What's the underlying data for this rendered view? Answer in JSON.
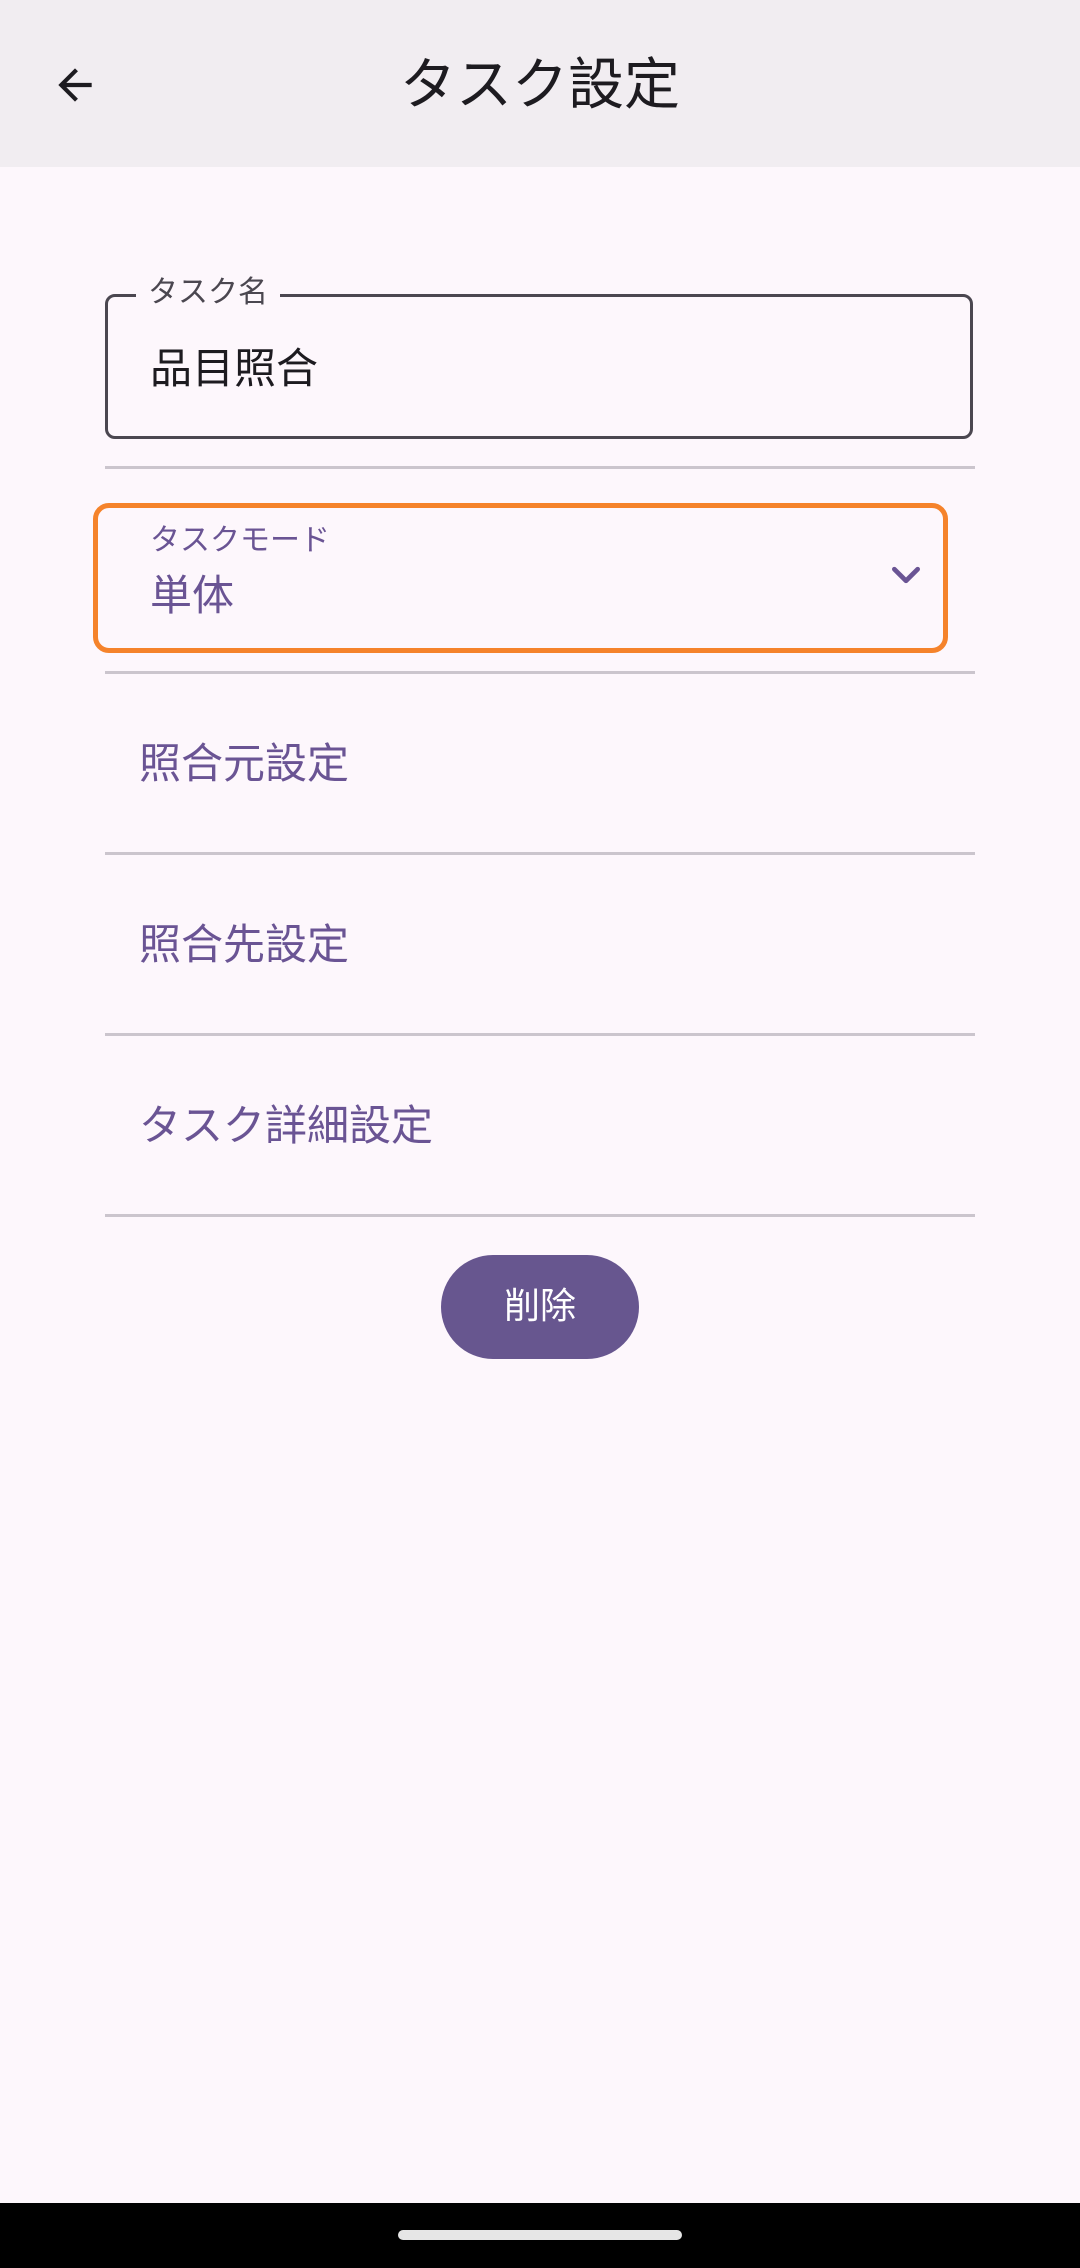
{
  "app_bar": {
    "title": "タスク設定",
    "back_icon": "arrow-back-icon"
  },
  "task_name_field": {
    "label": "タスク名",
    "value": "品目照合"
  },
  "task_mode_dropdown": {
    "label": "タスクモード",
    "selected_value": "単体",
    "icon": "chevron-down-icon",
    "highlight_color": "#f5832b"
  },
  "settings_items": [
    {
      "label": "照合元設定"
    },
    {
      "label": "照合先設定"
    },
    {
      "label": "タスク詳細設定"
    }
  ],
  "delete_button": {
    "label": "削除",
    "color": "#67568f"
  },
  "colors": {
    "background": "#fdf7fc",
    "app_bar": "#f1edf1",
    "accent": "#6a5494"
  }
}
